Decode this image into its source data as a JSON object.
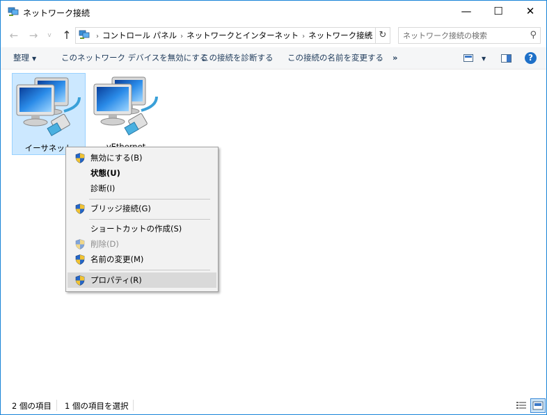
{
  "window": {
    "title": "ネットワーク接続"
  },
  "window_controls": {
    "minimize": "—",
    "maximize": "☐",
    "close": "✕"
  },
  "nav": {
    "back": "←",
    "forward": "→",
    "recent": "v",
    "up": "↑"
  },
  "address": {
    "crumbs": [
      "コントロール パネル",
      "ネットワークとインターネット",
      "ネットワーク接続"
    ],
    "separator": "›"
  },
  "search": {
    "placeholder": "ネットワーク接続の検索"
  },
  "toolbar": {
    "organize": "整理",
    "disable": "このネットワーク デバイスを無効にする",
    "diagnose": "この接続を診断する",
    "rename": "この接続の名前を変更する",
    "more": "»",
    "help": "?"
  },
  "items": [
    {
      "label": "イーサネット",
      "selected": true
    },
    {
      "label": "vEthernet",
      "selected": false
    }
  ],
  "context_menu": {
    "items": [
      {
        "label": "無効にする(B)",
        "shield": true,
        "bold": false,
        "disabled": false
      },
      {
        "label": "状態(U)",
        "shield": false,
        "bold": true,
        "disabled": false
      },
      {
        "label": "診断(I)",
        "shield": false,
        "bold": false,
        "disabled": false
      },
      {
        "label": "ブリッジ接続(G)",
        "shield": true,
        "bold": false,
        "disabled": false
      },
      {
        "label": "ショートカットの作成(S)",
        "shield": false,
        "bold": false,
        "disabled": false
      },
      {
        "label": "削除(D)",
        "shield": true,
        "bold": false,
        "disabled": true
      },
      {
        "label": "名前の変更(M)",
        "shield": true,
        "bold": false,
        "disabled": false
      },
      {
        "label": "プロパティ(R)",
        "shield": true,
        "bold": false,
        "disabled": false,
        "hover": true
      }
    ]
  },
  "status": {
    "count": "2 個の項目",
    "selected": "1 個の項目を選択"
  },
  "colors": {
    "accent": "#1883d7",
    "selection": "#cce8ff",
    "help": "#1e70c8"
  }
}
